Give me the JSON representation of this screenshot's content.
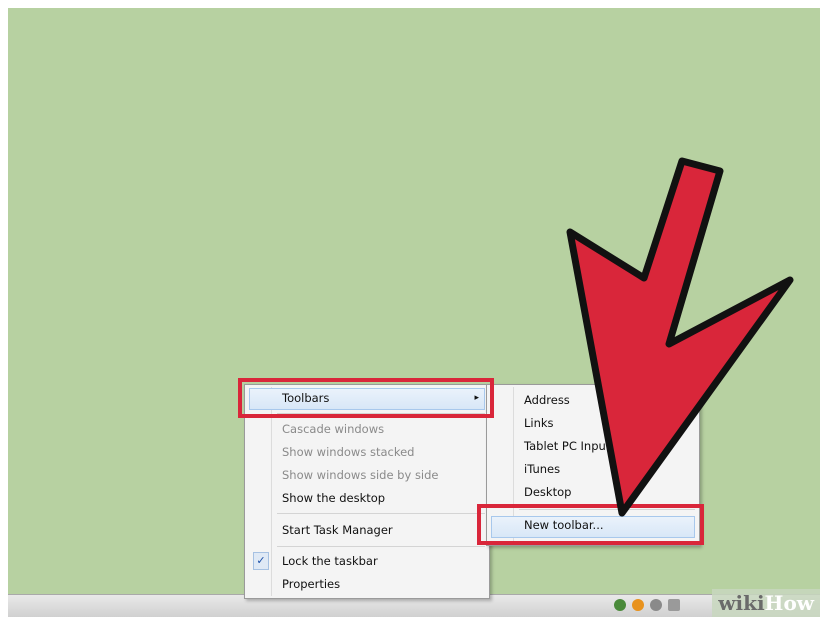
{
  "context_menu": {
    "items": [
      {
        "label": "Toolbars",
        "state": "highlighted",
        "submenu": true
      },
      {
        "label": "Cascade windows",
        "state": "disabled"
      },
      {
        "label": "Show windows stacked",
        "state": "disabled"
      },
      {
        "label": "Show windows side by side",
        "state": "disabled"
      },
      {
        "label": "Show the desktop",
        "state": "normal"
      },
      {
        "label": "Start Task Manager",
        "state": "normal"
      },
      {
        "label": "Lock the taskbar",
        "state": "checked"
      },
      {
        "label": "Properties",
        "state": "normal"
      }
    ],
    "check_mark": "✓",
    "submenu_arrow": "▸"
  },
  "toolbars_submenu": {
    "items": [
      {
        "label": "Address"
      },
      {
        "label": "Links"
      },
      {
        "label": "Tablet PC Input Panel"
      },
      {
        "label": "iTunes"
      },
      {
        "label": "Desktop"
      },
      {
        "label": "New toolbar...",
        "state": "highlighted"
      }
    ]
  },
  "annotation": {
    "color": "#d9263a",
    "arrow": "red-pointer-arrow"
  },
  "watermark": {
    "part1": "wiki",
    "part2": "How"
  },
  "colors": {
    "desktop": "#b7d1a1",
    "accent": "#d9263a"
  }
}
